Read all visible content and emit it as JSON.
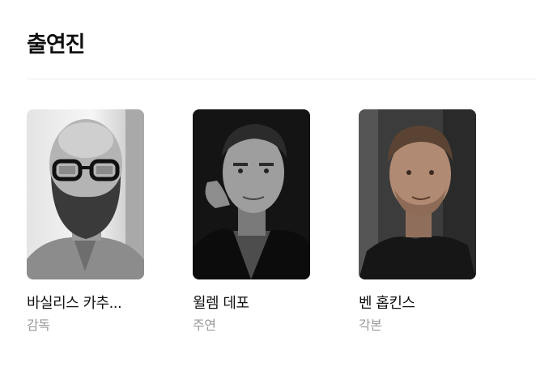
{
  "section": {
    "title": "출연진"
  },
  "cast": [
    {
      "name": "바실리스 카추...",
      "role": "감독"
    },
    {
      "name": "윌렘 데포",
      "role": "주연"
    },
    {
      "name": "벤 홉킨스",
      "role": "각본"
    }
  ]
}
